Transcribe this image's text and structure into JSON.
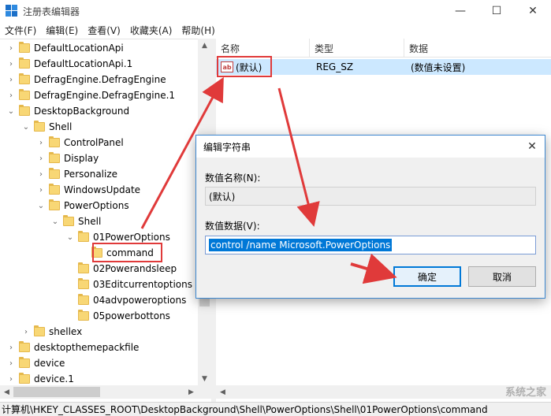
{
  "window": {
    "title": "注册表编辑器",
    "minimize": "—",
    "maximize": "☐",
    "close": "✕"
  },
  "menu": [
    "文件(F)",
    "编辑(E)",
    "查看(V)",
    "收藏夹(A)",
    "帮助(H)"
  ],
  "tree": [
    {
      "label": "DefaultLocationApi",
      "depth": 0,
      "chevron": "›"
    },
    {
      "label": "DefaultLocationApi.1",
      "depth": 0,
      "chevron": "›"
    },
    {
      "label": "DefragEngine.DefragEngine",
      "depth": 0,
      "chevron": "›"
    },
    {
      "label": "DefragEngine.DefragEngine.1",
      "depth": 0,
      "chevron": "›"
    },
    {
      "label": "DesktopBackground",
      "depth": 0,
      "chevron": "⌄"
    },
    {
      "label": "Shell",
      "depth": 1,
      "chevron": "⌄"
    },
    {
      "label": "ControlPanel",
      "depth": 2,
      "chevron": "›"
    },
    {
      "label": "Display",
      "depth": 2,
      "chevron": "›"
    },
    {
      "label": "Personalize",
      "depth": 2,
      "chevron": "›"
    },
    {
      "label": "WindowsUpdate",
      "depth": 2,
      "chevron": "›"
    },
    {
      "label": "PowerOptions",
      "depth": 2,
      "chevron": "⌄"
    },
    {
      "label": "Shell",
      "depth": 3,
      "chevron": "⌄"
    },
    {
      "label": "01PowerOptions",
      "depth": 4,
      "chevron": "⌄"
    },
    {
      "label": "command",
      "depth": 5,
      "chevron": ""
    },
    {
      "label": "02Powerandsleep",
      "depth": 4,
      "chevron": ""
    },
    {
      "label": "03Editcurrentoptions",
      "depth": 4,
      "chevron": ""
    },
    {
      "label": "04advpoweroptions",
      "depth": 4,
      "chevron": ""
    },
    {
      "label": "05powerbottons",
      "depth": 4,
      "chevron": ""
    },
    {
      "label": "shellex",
      "depth": 1,
      "chevron": "›"
    },
    {
      "label": "desktopthemepackfile",
      "depth": 0,
      "chevron": "›"
    },
    {
      "label": "device",
      "depth": 0,
      "chevron": "›"
    },
    {
      "label": "device.1",
      "depth": 0,
      "chevron": "›"
    }
  ],
  "list": {
    "columns": [
      "名称",
      "类型",
      "数据"
    ],
    "rows": [
      {
        "name": "(默认)",
        "type": "REG_SZ",
        "data": "(数值未设置)",
        "icon": "ab"
      }
    ]
  },
  "status_bar": "计算机\\HKEY_CLASSES_ROOT\\DesktopBackground\\Shell\\PowerOptions\\Shell\\01PowerOptions\\command",
  "dialog": {
    "title": "编辑字符串",
    "name_label": "数值名称(N):",
    "name_value": "(默认)",
    "data_label": "数值数据(V):",
    "data_value": "control /name Microsoft.PowerOptions",
    "ok_label": "确定",
    "cancel_label": "取消"
  },
  "watermark": "系统之家",
  "colors": {
    "highlight": "#e03a3a",
    "selection": "#cce8ff",
    "accent": "#0078d7"
  }
}
